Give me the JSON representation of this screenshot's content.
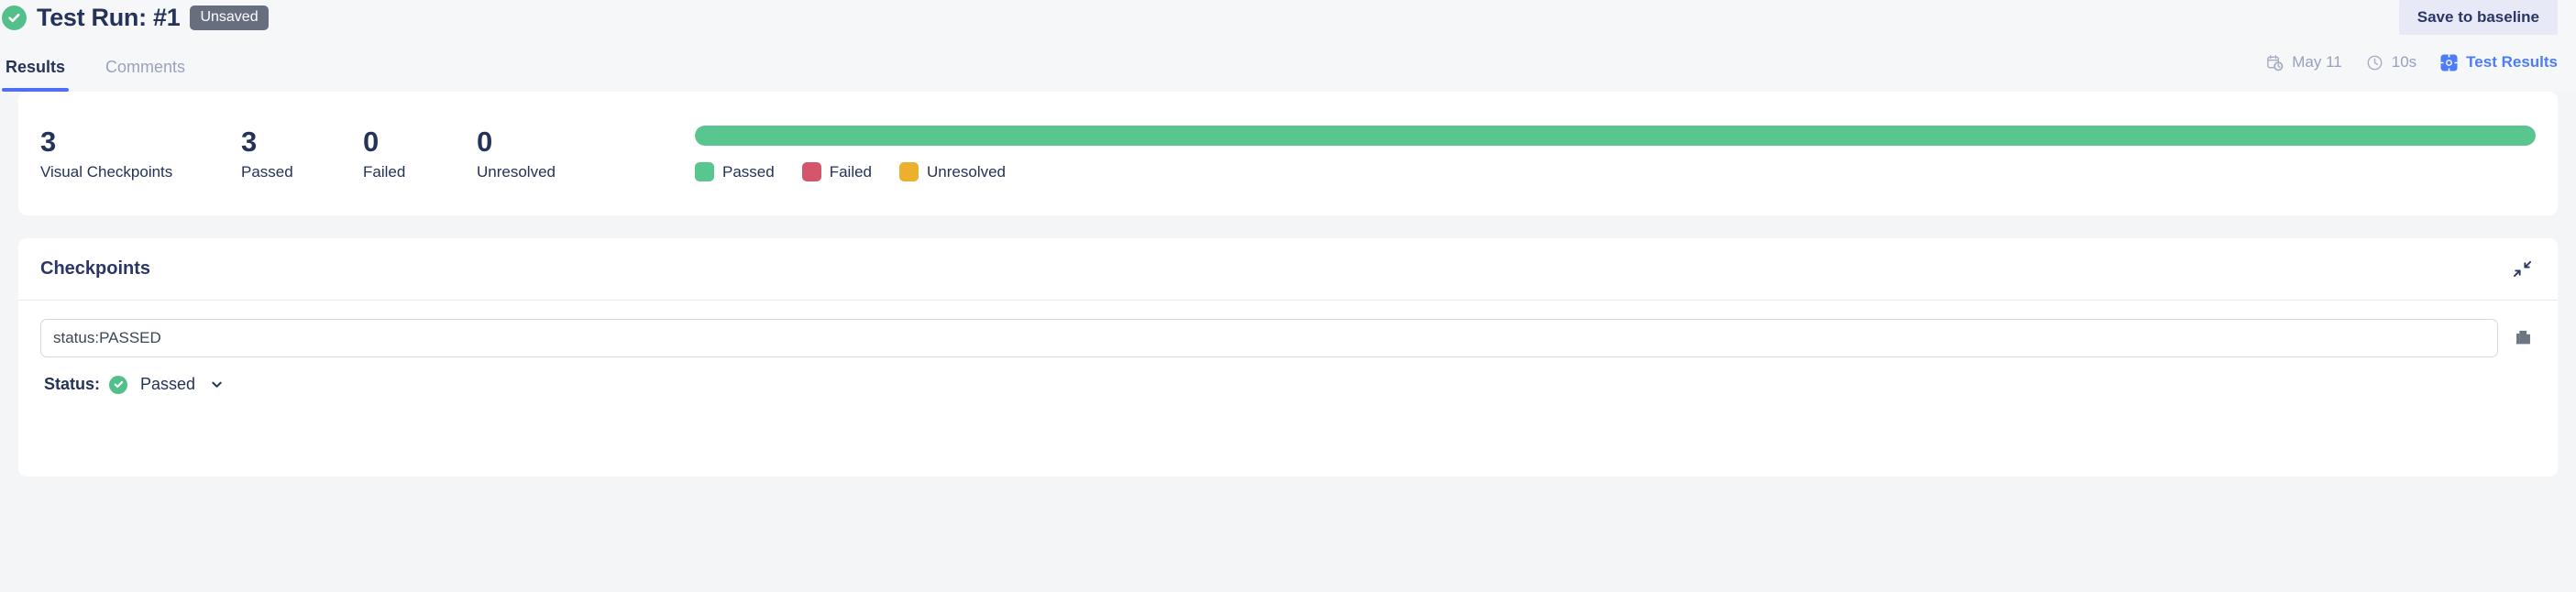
{
  "header": {
    "status_icon": "check-circle-icon",
    "title": "Test Run: #1",
    "badge": "Unsaved",
    "save_button": "Save to baseline",
    "accent_green": "#53c08b",
    "badge_bg": "#676f7e",
    "button_bg": "#e7eaf6"
  },
  "tabs": [
    {
      "label": "Results",
      "active": true
    },
    {
      "label": "Comments",
      "active": false
    }
  ],
  "meta": [
    {
      "icon": "calendar-clock-icon",
      "label": "May 11",
      "link": false
    },
    {
      "icon": "clock-icon",
      "label": "10s",
      "link": false
    },
    {
      "icon": "test-results-app-icon",
      "label": "Test Results",
      "link": true
    }
  ],
  "summary": {
    "stats": [
      {
        "value": "3",
        "label": "Visual Checkpoints"
      },
      {
        "value": "3",
        "label": "Passed"
      },
      {
        "value": "0",
        "label": "Failed"
      },
      {
        "value": "0",
        "label": "Unresolved"
      }
    ],
    "legend": [
      {
        "label": "Passed",
        "color": "#5ac68f"
      },
      {
        "label": "Failed",
        "color": "#d4566b"
      },
      {
        "label": "Unresolved",
        "color": "#edb02e"
      }
    ]
  },
  "chart_data": {
    "type": "bar",
    "title": "Checkpoint results distribution",
    "orientation": "horizontal-stacked",
    "categories": [
      "Passed",
      "Failed",
      "Unresolved"
    ],
    "values": [
      3,
      0,
      0
    ],
    "percentages": [
      100,
      0,
      0
    ],
    "colors": [
      "#5ac68f",
      "#d4566b",
      "#edb02e"
    ],
    "total": 3,
    "xlabel": "",
    "ylabel": "",
    "grid": false,
    "legend_position": "bottom-left"
  },
  "checkpoints": {
    "title": "Checkpoints",
    "collapse_icon": "collapse-arrows-icon",
    "filter_value": "status:PASSED",
    "filter_placeholder": "status:PASSED",
    "copy_icon": "copy-icon",
    "status_label": "Status:",
    "status_icon": "check-circle-icon",
    "status_value": "Passed",
    "chevron_icon": "chevron-down-icon"
  }
}
